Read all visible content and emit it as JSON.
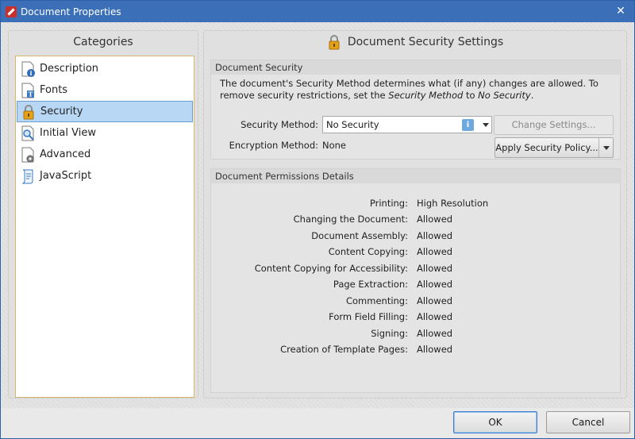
{
  "window": {
    "title": "Document Properties"
  },
  "left": {
    "heading": "Categories",
    "items": [
      {
        "label": "Description",
        "icon": "info-document-icon",
        "selected": false
      },
      {
        "label": "Fonts",
        "icon": "font-document-icon",
        "selected": false
      },
      {
        "label": "Security",
        "icon": "lock-icon",
        "selected": true
      },
      {
        "label": "Initial View",
        "icon": "magnifier-document-icon",
        "selected": false
      },
      {
        "label": "Advanced",
        "icon": "gear-document-icon",
        "selected": false
      },
      {
        "label": "JavaScript",
        "icon": "script-scroll-icon",
        "selected": false
      }
    ]
  },
  "right": {
    "heading": "Document Security Settings",
    "security_group": {
      "title": "Document Security",
      "description_part1": "The document's Security Method determines what (if any) changes are allowed. To remove security restrictions, set the ",
      "description_em1": "Security Method",
      "description_part2": " to ",
      "description_em2": "No Security",
      "description_part3": ".",
      "method_label": "Security Method:",
      "method_value": "No Security",
      "encryption_label": "Encryption Method:",
      "encryption_value": "None",
      "change_settings_label": "Change Settings...",
      "apply_policy_label": "Apply Security Policy..."
    },
    "permissions_group": {
      "title": "Document Permissions Details",
      "rows": [
        {
          "label": "Printing:",
          "value": "High Resolution"
        },
        {
          "label": "Changing the Document:",
          "value": "Allowed"
        },
        {
          "label": "Document Assembly:",
          "value": "Allowed"
        },
        {
          "label": "Content Copying:",
          "value": "Allowed"
        },
        {
          "label": "Content Copying for Accessibility:",
          "value": "Allowed"
        },
        {
          "label": "Page Extraction:",
          "value": "Allowed"
        },
        {
          "label": "Commenting:",
          "value": "Allowed"
        },
        {
          "label": "Form Field Filling:",
          "value": "Allowed"
        },
        {
          "label": "Signing:",
          "value": "Allowed"
        },
        {
          "label": "Creation of Template Pages:",
          "value": "Allowed"
        }
      ]
    }
  },
  "footer": {
    "ok_label": "OK",
    "cancel_label": "Cancel"
  },
  "colors": {
    "titlebar": "#3b70b9",
    "selection": "#b8d7f5",
    "list_border": "#d7b86a"
  }
}
